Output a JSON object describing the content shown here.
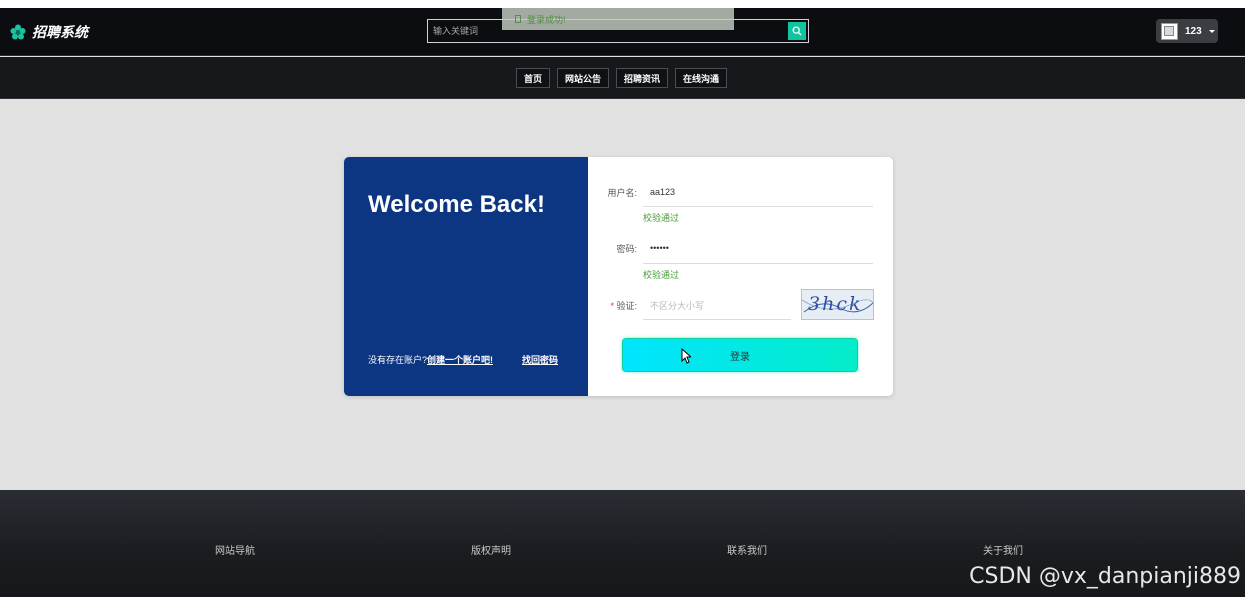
{
  "app": {
    "logo_text": "招聘系统",
    "logo_icon": "flower-icon",
    "accent_color": "#12c3a0"
  },
  "search": {
    "placeholder": "输入关键词",
    "button_icon": "search-icon"
  },
  "toast": {
    "message": "登录成功!"
  },
  "user": {
    "name": "123",
    "avatar": "broken-image-icon"
  },
  "nav": {
    "items": [
      "首页",
      "网站公告",
      "招聘资讯",
      "在线沟通"
    ]
  },
  "login_card": {
    "welcome_title": "Welcome Back!",
    "no_account_text": "没有存在账户?",
    "register_link": "创建一个账户吧!",
    "forgot_link": "找回密码",
    "panel_color": "#0c3582",
    "username_label": "用户名:",
    "username_value": "aa123",
    "username_valid": "校验通过",
    "password_label": "密码:",
    "password_value": "••••••",
    "password_valid": "校验通过",
    "captcha_star": "*",
    "captcha_label": "验证:",
    "captcha_placeholder": "不区分大小写",
    "captcha_text": "3hck",
    "login_button": "登录"
  },
  "footer": {
    "items": [
      "网站导航",
      "版权声明",
      "联系我们",
      "关于我们"
    ]
  },
  "watermark": "CSDN @vx_danpianji889"
}
